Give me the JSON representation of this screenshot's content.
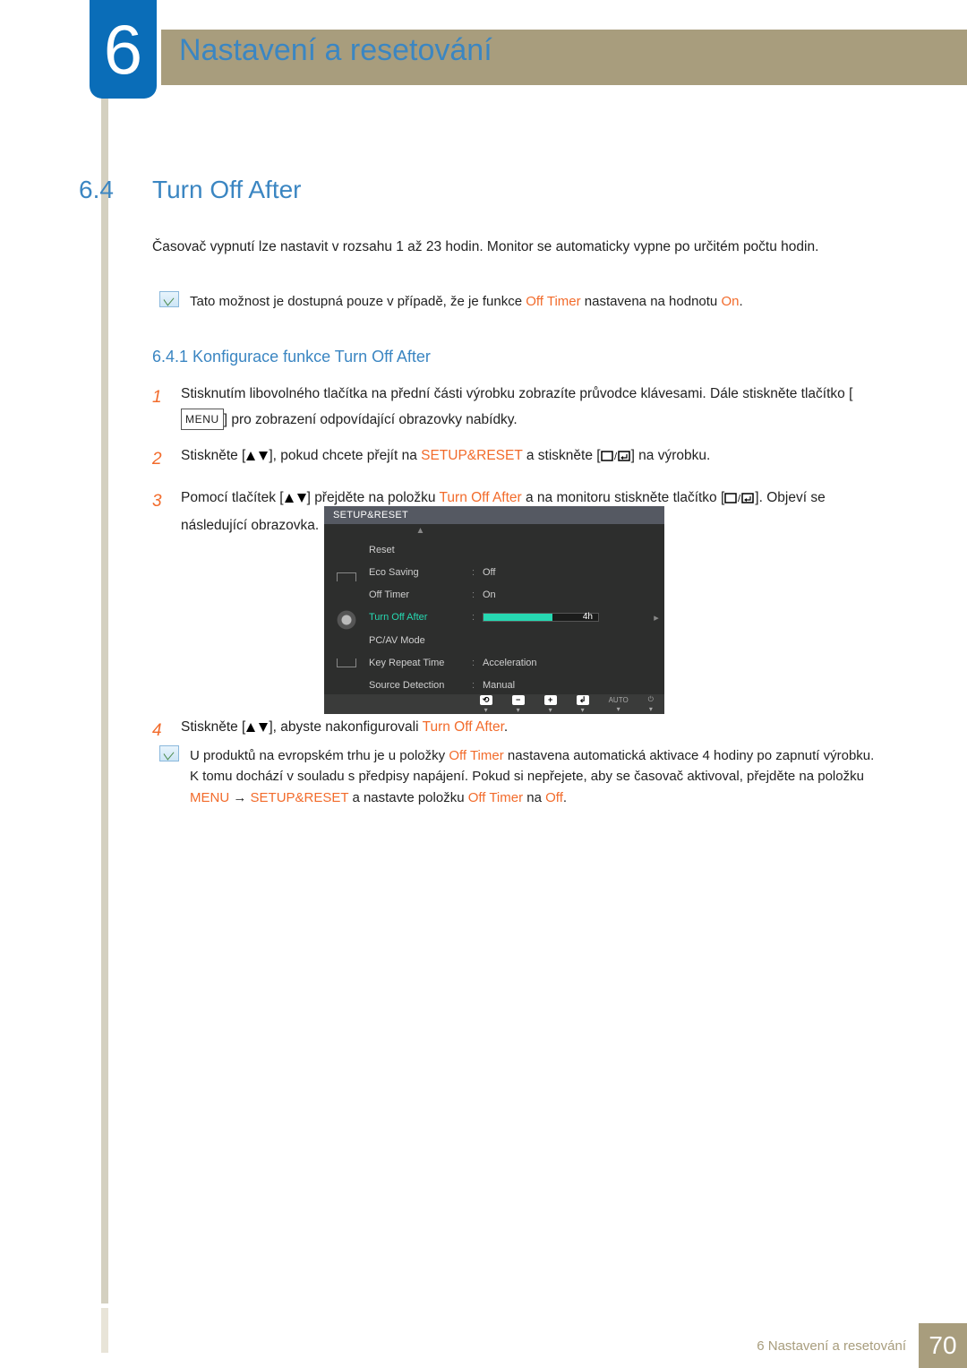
{
  "chapter": {
    "number": "6",
    "title": "Nastavení a resetování"
  },
  "section": {
    "number": "6.4",
    "title": "Turn Off After"
  },
  "intro": "Časovač vypnutí lze nastavit v rozsahu 1 až 23 hodin. Monitor se automaticky vypne po určitém počtu hodin.",
  "note1": {
    "pre": "Tato možnost je dostupná pouze v případě, že je funkce ",
    "hl1": "Off Timer",
    "mid": " nastavena na hodnotu ",
    "hl2": "On",
    "post": "."
  },
  "subsection": "6.4.1   Konfigurace funkce Turn Off After",
  "steps": {
    "s1": {
      "num": "1",
      "a": "Stisknutím libovolného tlačítka na přední části výrobku zobrazíte průvodce klávesami. Dále stiskněte tlačítko [",
      "menu": "MENU",
      "b": "] pro zobrazení odpovídající obrazovky nabídky."
    },
    "s2": {
      "num": "2",
      "a": "Stiskněte [",
      "b": "], pokud chcete přejít na ",
      "hl": "SETUP&RESET",
      "c": " a stiskněte [",
      "d": "] na výrobku."
    },
    "s3": {
      "num": "3",
      "a": "Pomocí tlačítek [",
      "b": "] přejděte na položku ",
      "hl": "Turn Off After",
      "c": " a na monitoru stiskněte tlačítko [",
      "d": "]. Objeví se následující obrazovka."
    },
    "s4": {
      "num": "4",
      "a": "Stiskněte [",
      "b": "], abyste nakonfigurovali ",
      "hl": "Turn Off After",
      "c": "."
    }
  },
  "osd": {
    "title": "SETUP&RESET",
    "rows": [
      {
        "label": "Reset",
        "value": ""
      },
      {
        "label": "Eco Saving",
        "value": "Off"
      },
      {
        "label": "Off Timer",
        "value": "On"
      },
      {
        "label": "Turn Off After",
        "value": "4h",
        "highlight": true,
        "slider_pct": 60
      },
      {
        "label": "PC/AV Mode",
        "value": ""
      },
      {
        "label": "Key Repeat Time",
        "value": "Acceleration"
      },
      {
        "label": "Source Detection",
        "value": "Manual"
      }
    ],
    "footer_auto": "AUTO"
  },
  "note2": {
    "a": "U produktů na evropském trhu je u položky ",
    "hl1": "Off Timer",
    "b": " nastavena automatická aktivace 4 hodiny po zapnutí výrobku. K tomu dochází v souladu s předpisy napájení. Pokud si nepřejete, aby se časovač aktivoval, přejděte na položku ",
    "hl2": "MENU",
    "arrow": " → ",
    "hl3": "SETUP&RESET",
    "c": " a nastavte položku ",
    "hl4": "Off Timer",
    "d": " na ",
    "hl5": "Off",
    "e": "."
  },
  "footer": {
    "text": "6 Nastavení a resetování",
    "page": "70"
  }
}
